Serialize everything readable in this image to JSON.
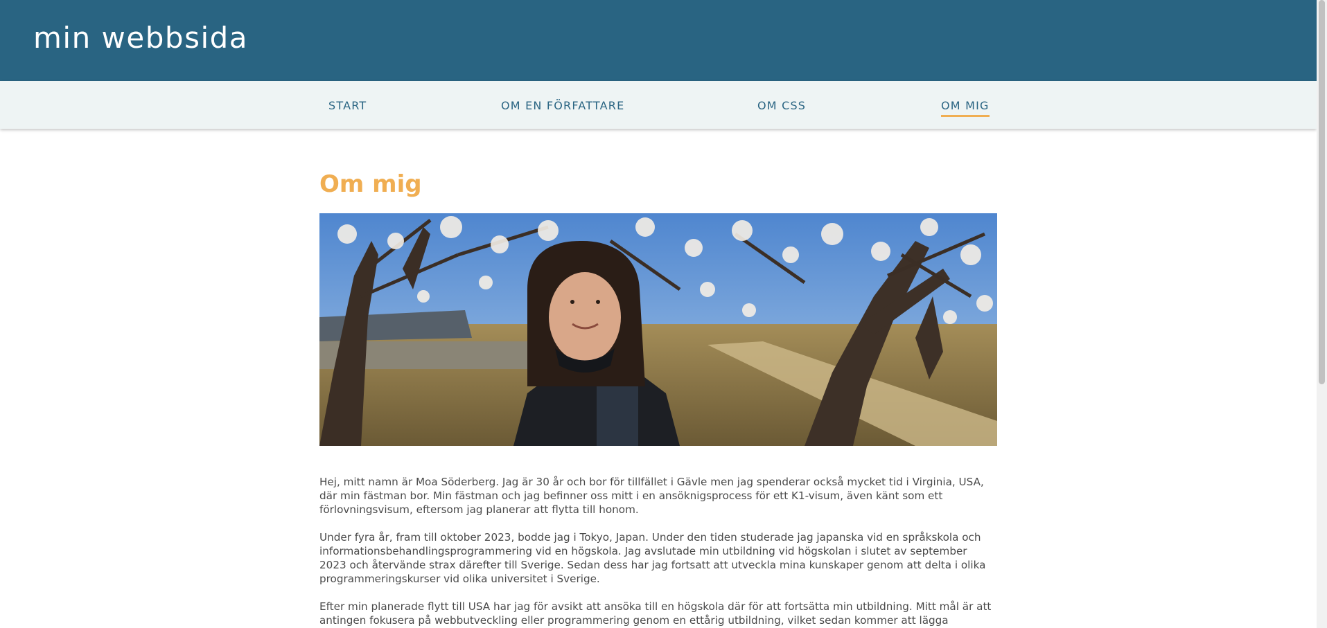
{
  "site": {
    "title": "min webbsida"
  },
  "nav": {
    "items": [
      {
        "label": "START"
      },
      {
        "label": "OM EN FÖRFATTARE"
      },
      {
        "label": "OM CSS"
      },
      {
        "label": "OM MIG"
      }
    ],
    "active_index": 3
  },
  "main": {
    "heading": "Om mig",
    "paragraphs": [
      "Hej, mitt namn är Moa Söderberg. Jag är 30 år och bor för tillfället i Gävle men jag spenderar också mycket tid i Virginia, USA, där min fästman bor. Min fästman och jag befinner oss mitt i en ansöknigsprocess för ett K1-visum, även känt som ett förlovningsvisum, eftersom jag planerar att flytta till honom.",
      "Under fyra år, fram till oktober 2023, bodde jag i Tokyo, Japan. Under den tiden studerade jag japanska vid en språkskola och informationsbehandlingsprogrammering vid en högskola. Jag avslutade min utbildning vid högskolan i slutet av september 2023 och återvände strax därefter till Sverige. Sedan dess har jag fortsatt att utveckla mina kunskaper genom att delta i olika programmeringskurser vid olika universitet i Sverige.",
      "Efter min planerade flytt till USA har jag för avsikt att ansöka till en högskola där för att fortsätta min utbildning. Mitt mål är att antingen fokusera på webbutveckling eller programmering genom en ettårig utbildning, vilket sedan kommer att lägga"
    ]
  },
  "colors": {
    "header_bg": "#296482",
    "nav_bg": "#eef4f4",
    "accent": "#f0ae52",
    "text": "#4a4a4a"
  }
}
